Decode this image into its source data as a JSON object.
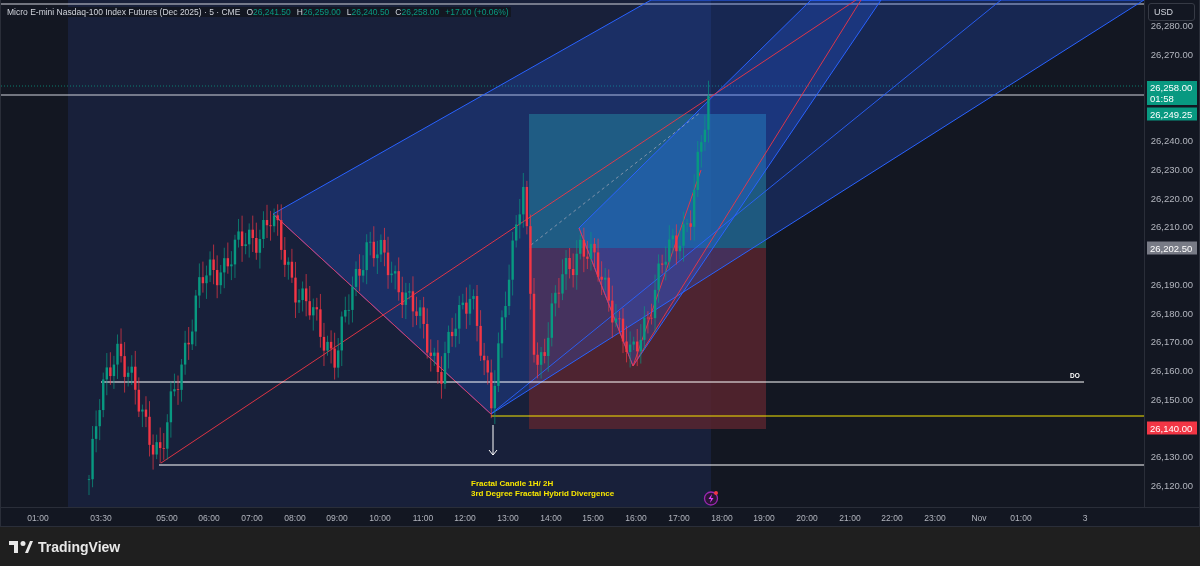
{
  "legend": {
    "symbol": "Micro E-mini Nasdaq-100 Index Futures (Dec 2025) · 5 · CME",
    "values": [
      {
        "label": "O",
        "value": "26,241.50"
      },
      {
        "label": "H",
        "value": "26,259.00"
      },
      {
        "label": "L",
        "value": "26,240.50"
      },
      {
        "label": "C",
        "value": "26,258.00"
      }
    ],
    "change": "+17.00 (+0.06%)"
  },
  "currency": "USD",
  "price_axis": [
    "26,280.00",
    "26,270.00",
    "26,240.00",
    "26,230.00",
    "26,220.00",
    "26,210.00",
    "26,190.00",
    "26,180.00",
    "26,170.00",
    "26,160.00",
    "26,150.00",
    "26,130.00",
    "26,120.00"
  ],
  "price_badges": [
    {
      "price": "26,258.00",
      "countdown": "01:58",
      "color": "#089981"
    },
    {
      "price": "26,249.25",
      "color": "#089981"
    },
    {
      "price": "26,202.50",
      "color": "#787b86"
    },
    {
      "price": "26,140.00",
      "color": "#f23645"
    }
  ],
  "time_axis": [
    "01:00",
    "03:30",
    "05:00",
    "06:00",
    "07:00",
    "08:00",
    "09:00",
    "10:00",
    "11:00",
    "12:00",
    "13:00",
    "14:00",
    "15:00",
    "16:00",
    "17:00",
    "18:00",
    "19:00",
    "20:00",
    "21:00",
    "22:00",
    "23:00",
    "Nov",
    "01:00",
    "3"
  ],
  "annotations": {
    "level_label": "DO",
    "note": [
      "Fractal Candle 1H/ 2H",
      "3rd Degree Fractal Hybrid Divergence"
    ]
  },
  "brand": "TradingView"
}
